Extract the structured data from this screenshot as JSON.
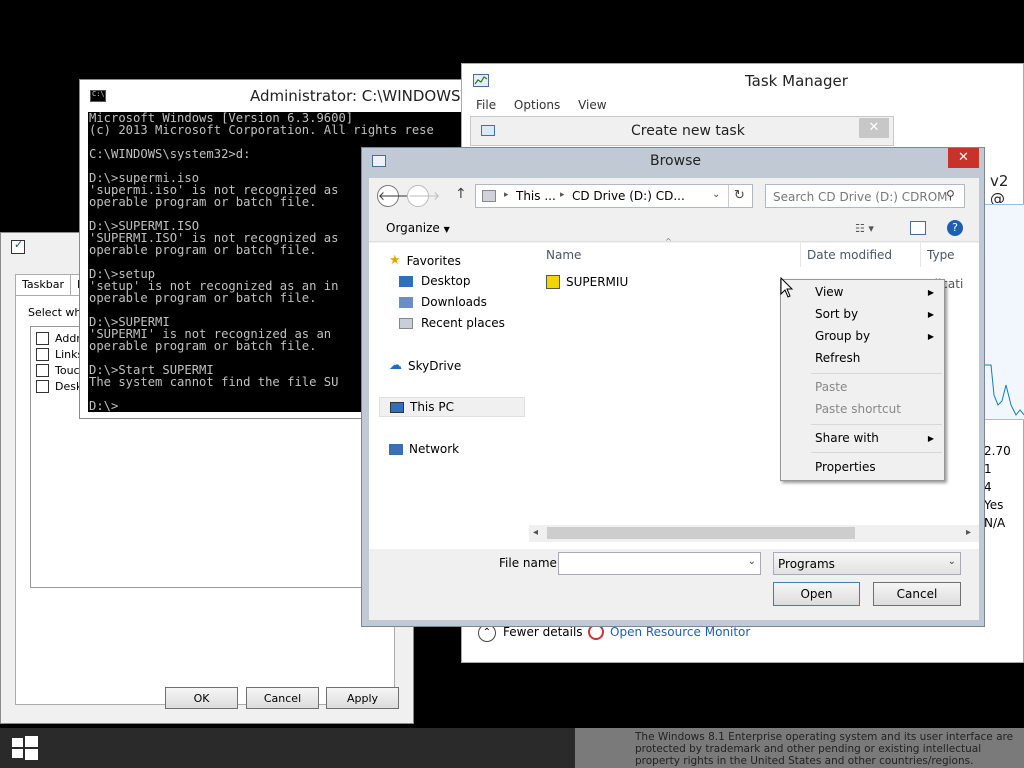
{
  "tbprops": {
    "tabs": [
      "Taskbar",
      "N"
    ],
    "group_label": "Select whi",
    "checkboxes": [
      "Addre",
      "Links",
      "Touch",
      "Deskt"
    ],
    "ok": "OK",
    "cancel": "Cancel",
    "apply": "Apply"
  },
  "cmd": {
    "title": "Administrator: C:\\WINDOWS\\sys",
    "lines": "Microsoft Windows [Version 6.3.9600]\n(c) 2013 Microsoft Corporation. All rights rese\n\nC:\\WINDOWS\\system32>d:\n\nD:\\>supermi.iso\n'supermi.iso' is not recognized as\noperable program or batch file.\n\nD:\\>SUPERMI.ISO\n'SUPERMI.ISO' is not recognized as\noperable program or batch file.\n\nD:\\>setup\n'setup' is not recognized as an in\noperable program or batch file.\n\nD:\\>SUPERMI\n'SUPERMI' is not recognized as an\noperable program or batch file.\n\nD:\\>Start SUPERMI\nThe system cannot find the file SU\n\nD:\\>"
  },
  "taskmanager": {
    "title": "Task Manager",
    "menu": [
      "File",
      "Options",
      "View"
    ],
    "cpu_text": "v2 @",
    "stats": [
      "2.70",
      "1",
      "4",
      "Yes",
      "N/A"
    ],
    "fewer_details": "Fewer details",
    "resource_monitor": "Open Resource Monitor"
  },
  "create_new_task": {
    "title": "Create new task"
  },
  "browse": {
    "title": "Browse",
    "breadcrumb_1": "This ...",
    "breadcrumb_2": "CD Drive (D:) CD...",
    "search_placeholder": "Search CD Drive (D:) CDROM",
    "organize": "Organize",
    "columns": {
      "name": "Name",
      "date": "Date modified",
      "type": "Type"
    },
    "type_partial": "plicati",
    "file": "SUPERMIU",
    "nav": {
      "favorites": "Favorites",
      "desktop": "Desktop",
      "downloads": "Downloads",
      "recent": "Recent places",
      "skydrive": "SkyDrive",
      "thispc": "This PC",
      "network": "Network"
    },
    "filename_label": "File name:",
    "filename_value": "",
    "filter": "Programs",
    "open": "Open",
    "cancel": "Cancel"
  },
  "context_menu": {
    "view": "View",
    "sort_by": "Sort by",
    "group_by": "Group by",
    "refresh": "Refresh",
    "paste": "Paste",
    "paste_shortcut": "Paste shortcut",
    "share_with": "Share with",
    "properties": "Properties"
  },
  "legal_text": "The Windows 8.1 Enterprise operating system and its user interface are protected by trademark and other pending or existing intellectual property rights in the United States and other countries/regions."
}
